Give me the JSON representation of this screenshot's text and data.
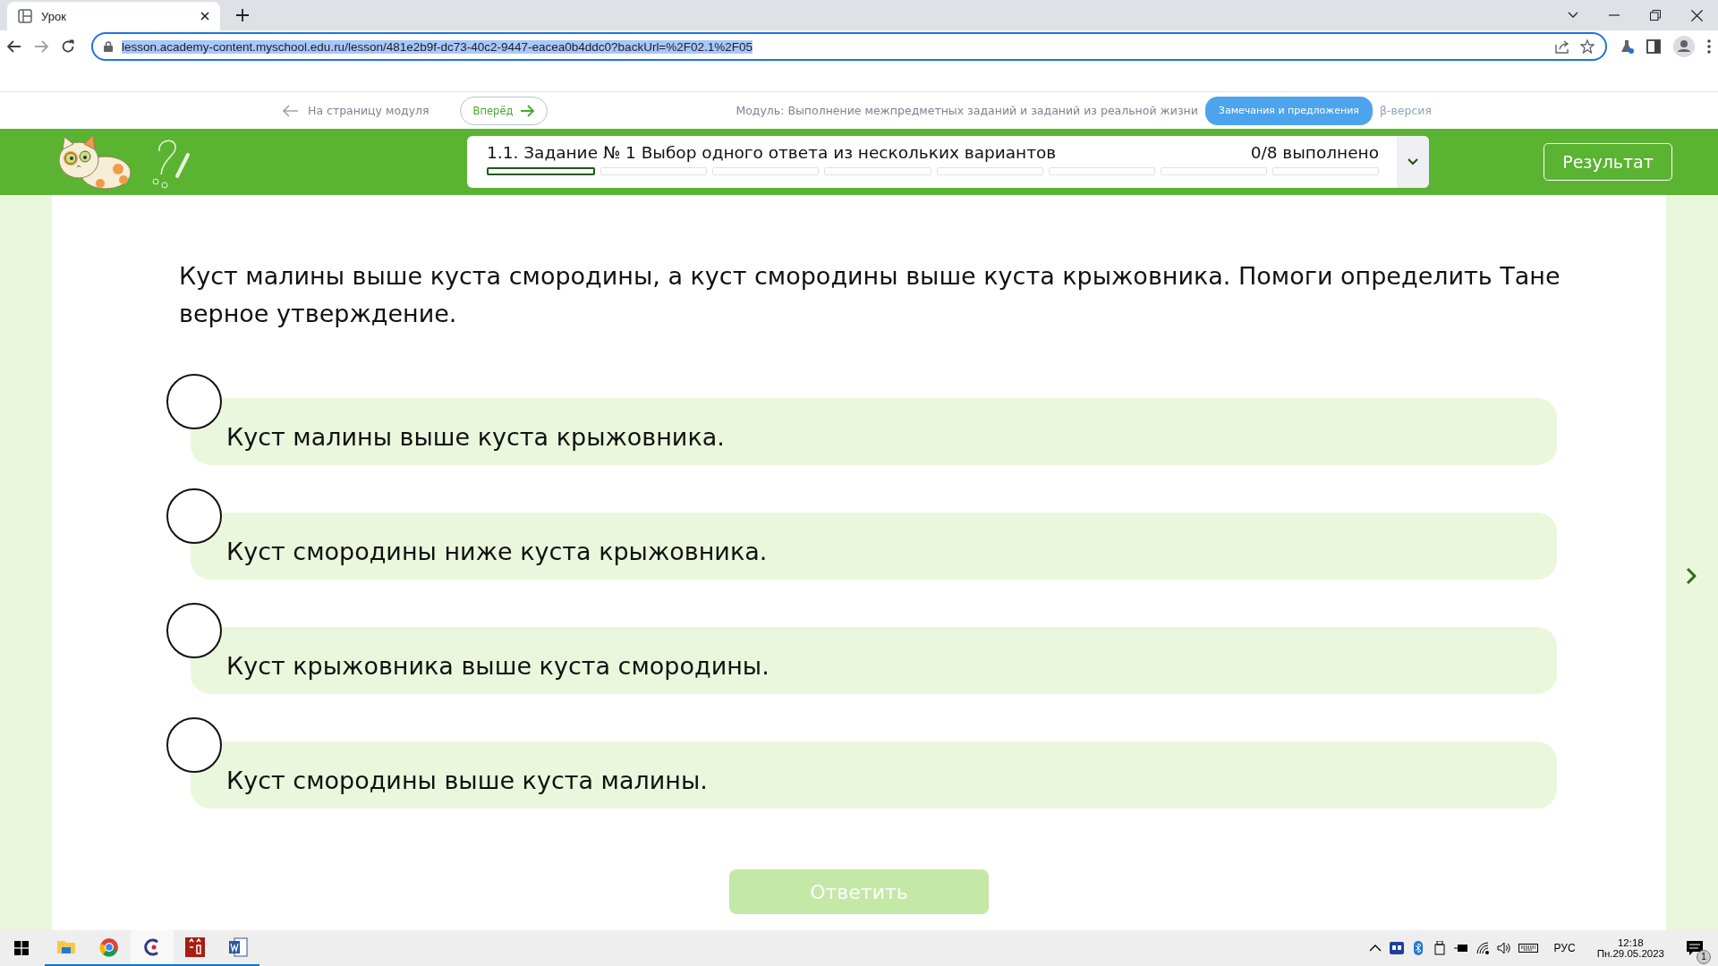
{
  "browser": {
    "tab": {
      "title": "Урок"
    },
    "address": "lesson.academy-content.myschool.edu.ru/lesson/481e2b9f-dc73-40c2-9447-eacea0b4ddc0?backUrl=%2F02.1%2F05"
  },
  "nav": {
    "back_link": "На страницу модуля",
    "forward_button": "Вперёд",
    "module": "Модуль: Выполнение межпредметных заданий и заданий из реальной жизни",
    "feedback_button": "Замечания и предложения",
    "beta": "β-версия"
  },
  "task_bar": {
    "title": "1.1. Задание № 1 Выбор одного ответа из нескольких вариантов",
    "progress": "0/8 выполнено",
    "segments": [
      {
        "selected": true
      },
      {
        "selected": false
      },
      {
        "selected": false
      },
      {
        "selected": false
      },
      {
        "selected": false
      },
      {
        "selected": false
      },
      {
        "selected": false
      },
      {
        "selected": false
      }
    ],
    "result_button": "Результат"
  },
  "question": "Куст малины выше куста смородины, а куст смородины выше куста крыжовника. Помоги определить Тане верное утверждение.",
  "options": [
    {
      "text": "Куст малины выше куста крыжовника.",
      "selected": false
    },
    {
      "text": "Куст смородины ниже куста крыжовника.",
      "selected": false
    },
    {
      "text": "Куст крыжовника выше куста смородины.",
      "selected": false
    },
    {
      "text": "Куст смородины выше куста малины.",
      "selected": false
    }
  ],
  "submit": {
    "label": "Ответить",
    "disabled": true
  },
  "taskbar": {
    "language": "РУС",
    "time": "12:18",
    "date": "Пн.29.05.2023",
    "notifications": "1"
  }
}
